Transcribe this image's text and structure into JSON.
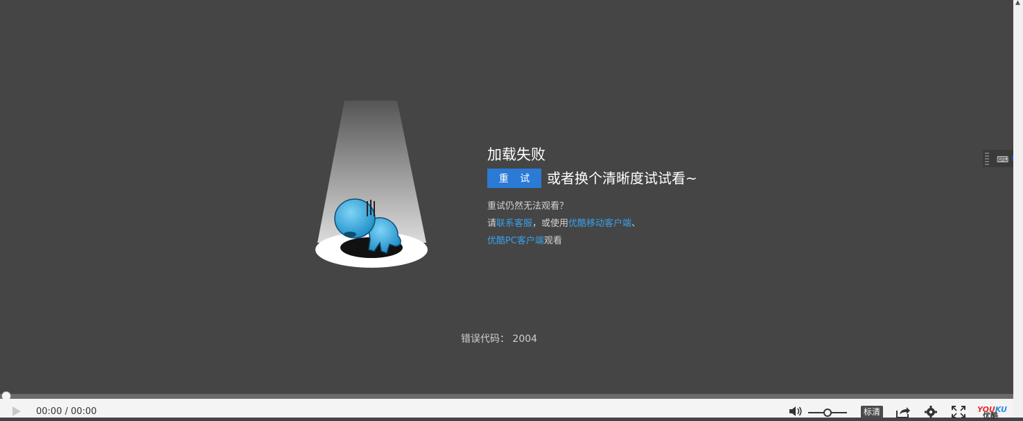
{
  "error": {
    "title": "加载失败",
    "retry_label": "重 试",
    "alt_text": "或者换个清晰度试试看~",
    "cannot_watch": "重试仍然无法观看？",
    "please": "请",
    "contact_link": "联系客服",
    "or_use": "，或使用",
    "mobile_client_link": "优酷移动客户端",
    "separator": "、",
    "pc_client_link": "优酷PC客户端",
    "watch": "观看",
    "code_label": "错误代码：",
    "code_value": "2004"
  },
  "controls": {
    "time": "00:00 / 00:00",
    "quality": "标清",
    "logo_en_1": "YOU",
    "logo_en_2": "KU",
    "logo_cn": "优酷"
  },
  "colors": {
    "background": "#454545",
    "accent": "#2a7ad6",
    "link": "#3aa0ea"
  }
}
